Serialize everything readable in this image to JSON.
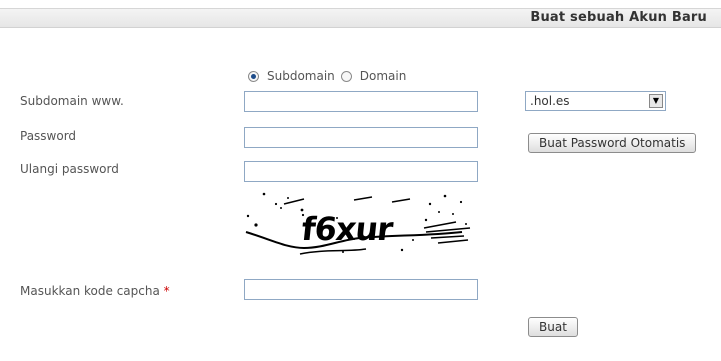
{
  "header": {
    "title": "Buat sebuah Akun Baru"
  },
  "domain_type": {
    "options": [
      {
        "label": "Subdomain",
        "selected": true
      },
      {
        "label": "Domain",
        "selected": false
      }
    ]
  },
  "fields": {
    "subdomain": {
      "label": "Subdomain www.",
      "value": ""
    },
    "password": {
      "label": "Password",
      "value": ""
    },
    "repeat_password": {
      "label": "Ulangi password",
      "value": ""
    },
    "captcha": {
      "label": "Masukkan kode capcha",
      "required_mark": "*",
      "value": ""
    }
  },
  "domain_select": {
    "selected": ".hol.es"
  },
  "captcha_image": {
    "text": "f6xur"
  },
  "buttons": {
    "auto_password": "Buat Password Otomatis",
    "submit": "Buat"
  },
  "colors": {
    "required": "#cc0000",
    "input_border": "#8fa8c4",
    "radio_dot": "#1e4c8a"
  }
}
